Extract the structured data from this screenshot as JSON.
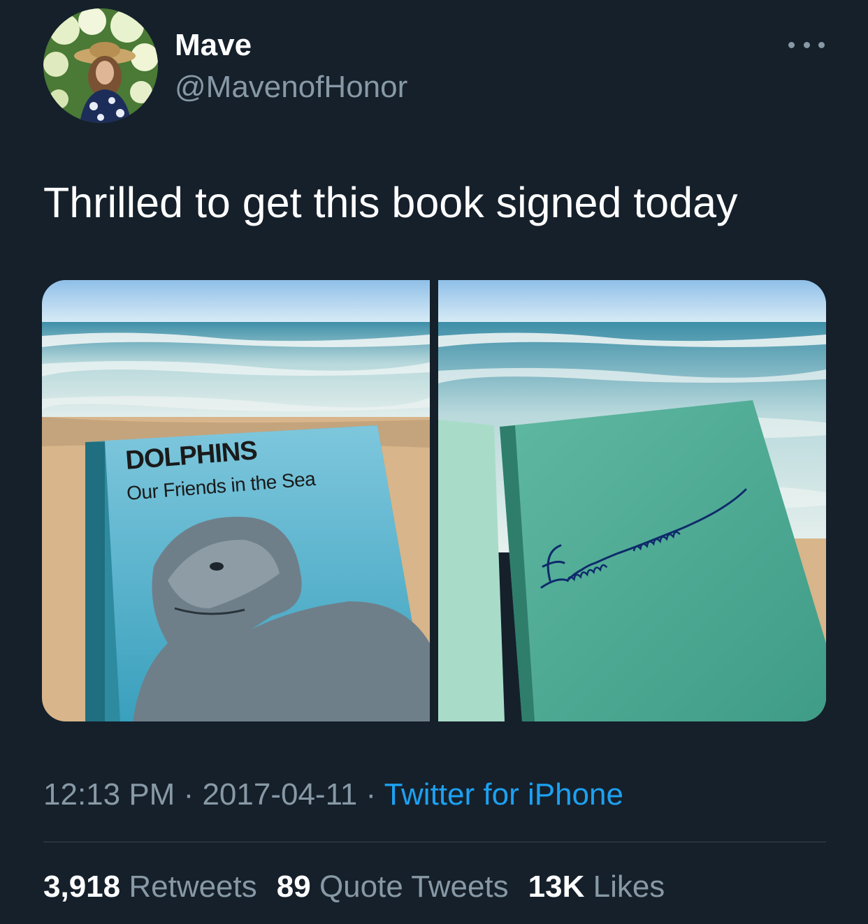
{
  "tweet": {
    "author": {
      "display_name": "Mave",
      "handle": "@MavenofHonor"
    },
    "text": "Thrilled to get this book signed today",
    "media": {
      "photo1": {
        "book_title": "DOLPHINS",
        "book_subtitle": "Our Friends in the Sea"
      }
    },
    "meta": {
      "time": "12:13 PM",
      "separator": " · ",
      "date": "2017-04-11",
      "source": "Twitter for iPhone"
    },
    "stats": {
      "retweets_count": "3,918",
      "retweets_label": "Retweets",
      "quotes_count": "89",
      "quotes_label": "Quote Tweets",
      "likes_count": "13K",
      "likes_label": "Likes"
    }
  },
  "colors": {
    "background": "#15202b",
    "primary_text": "#ffffff",
    "secondary_text": "#8899a6",
    "link": "#1da1f2",
    "divider": "#38444d"
  },
  "icons": {
    "more": "more-horizontal-icon"
  }
}
